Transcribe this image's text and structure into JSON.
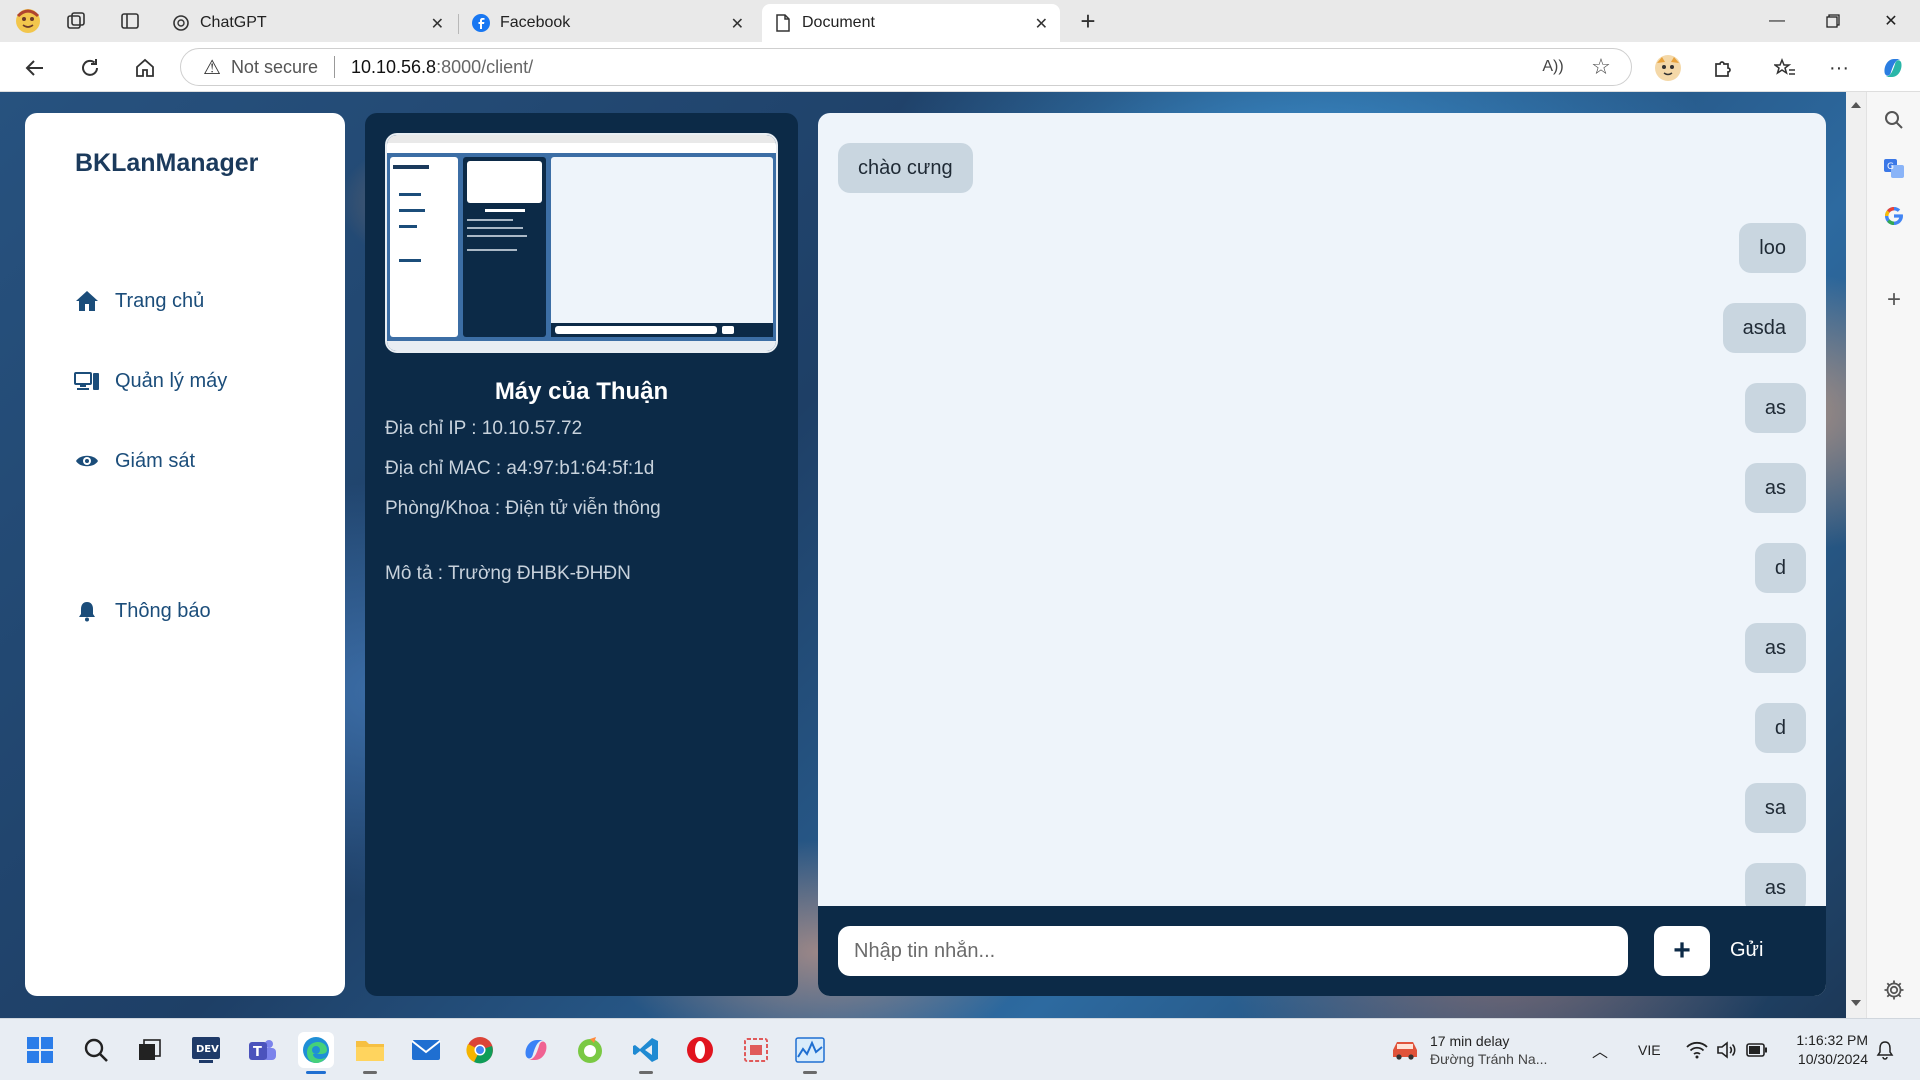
{
  "browser": {
    "tabs": [
      {
        "title": "ChatGPT",
        "icon": "chatgpt-icon"
      },
      {
        "title": "Facebook",
        "icon": "facebook-icon"
      },
      {
        "title": "Document",
        "icon": "document-icon",
        "active": true
      }
    ],
    "address": {
      "security_label": "Not secure",
      "host": "10.10.56.8",
      "path": ":8000/client/"
    }
  },
  "sidebar": {
    "brand": "BKLanManager",
    "items": [
      {
        "label": "Trang chủ",
        "icon": "home-icon"
      },
      {
        "label": "Quản lý máy",
        "icon": "devices-icon"
      },
      {
        "label": "Giám sát",
        "icon": "eye-icon"
      },
      {
        "label": "Thông báo",
        "icon": "bell-icon"
      }
    ]
  },
  "machine": {
    "name": "Máy của Thuận",
    "ip_line": "Địa chỉ IP : 10.10.57.72",
    "mac_line": "Địa chỉ MAC : a4:97:b1:64:5f:1d",
    "dept_line": "Phòng/Khoa : Điện tử viễn thông",
    "desc_line": "Mô tả : Trường ĐHBK-ĐHĐN"
  },
  "chat": {
    "messages": [
      {
        "text": "chào cưng",
        "side": "left"
      },
      {
        "text": "loo",
        "side": "right"
      },
      {
        "text": "asda",
        "side": "right"
      },
      {
        "text": "as",
        "side": "right"
      },
      {
        "text": "as",
        "side": "right"
      },
      {
        "text": "d",
        "side": "right"
      },
      {
        "text": "as",
        "side": "right"
      },
      {
        "text": "d",
        "side": "right"
      },
      {
        "text": "sa",
        "side": "right"
      },
      {
        "text": "as",
        "side": "right"
      }
    ],
    "input_placeholder": "Nhập tin nhắn...",
    "plus_label": "+",
    "send_label": "Gửi"
  },
  "taskbar": {
    "weather_title": "17 min delay",
    "weather_sub": "Đường Tránh Na...",
    "language": "VIE",
    "time": "1:16:32 PM",
    "date": "10/30/2024"
  },
  "colors": {
    "panel_dark": "#0c2a47",
    "accent_text": "#1b4d7a",
    "bubble": "#c9d6e0",
    "chat_bg": "#eef4fa"
  }
}
